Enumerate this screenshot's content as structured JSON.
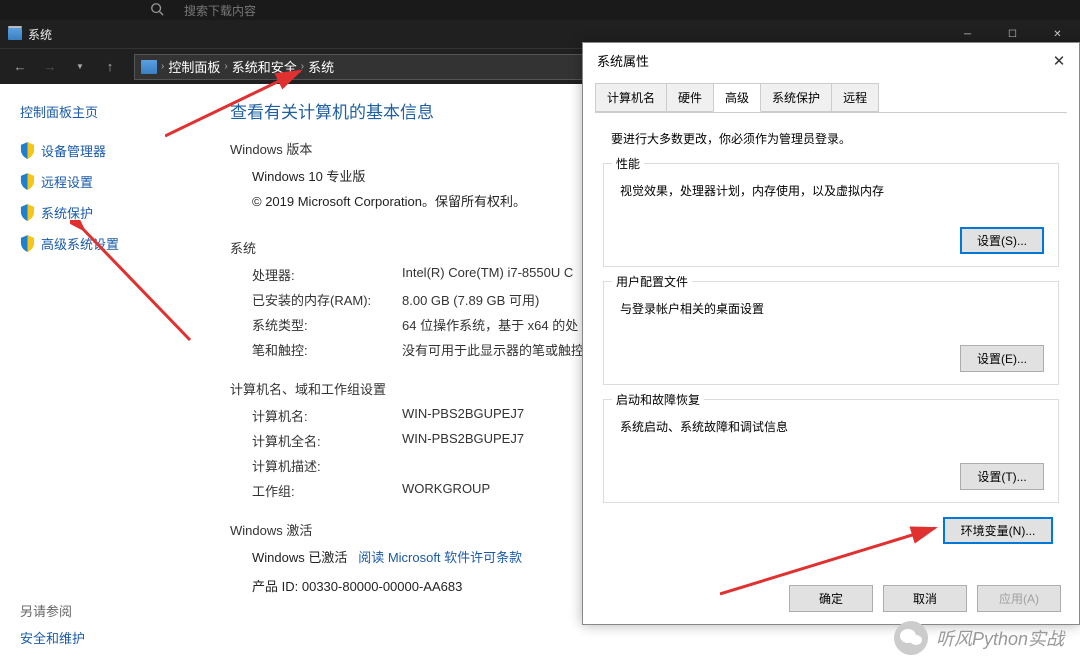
{
  "top_strip": {
    "search_placeholder": "搜索下载内容"
  },
  "title_bar": {
    "title": "系统"
  },
  "breadcrumb": {
    "items": [
      "控制面板",
      "系统和安全",
      "系统"
    ]
  },
  "sidebar": {
    "home": "控制面板主页",
    "items": [
      {
        "label": "设备管理器"
      },
      {
        "label": "远程设置"
      },
      {
        "label": "系统保护"
      },
      {
        "label": "高级系统设置"
      }
    ],
    "footer_title": "另请参阅",
    "footer_link": "安全和维护"
  },
  "main": {
    "heading": "查看有关计算机的基本信息",
    "win_edition_title": "Windows 版本",
    "win_edition": "Windows 10 专业版",
    "copyright": "© 2019 Microsoft Corporation。保留所有权利。",
    "system_title": "系统",
    "rows": {
      "cpu_k": "处理器:",
      "cpu_v": "Intel(R) Core(TM) i7-8550U C",
      "ram_k": "已安装的内存(RAM):",
      "ram_v": "8.00 GB (7.89 GB 可用)",
      "type_k": "系统类型:",
      "type_v": "64 位操作系统，基于 x64 的处",
      "pen_k": "笔和触控:",
      "pen_v": "没有可用于此显示器的笔或触控"
    },
    "name_title": "计算机名、域和工作组设置",
    "name_rows": {
      "name_k": "计算机名:",
      "name_v": "WIN-PBS2BGUPEJ7",
      "full_k": "计算机全名:",
      "full_v": "WIN-PBS2BGUPEJ7",
      "desc_k": "计算机描述:",
      "desc_v": "",
      "wg_k": "工作组:",
      "wg_v": "WORKGROUP"
    },
    "act_title": "Windows 激活",
    "act_status": "Windows 已激活",
    "act_link": "阅读 Microsoft 软件许可条款",
    "pid_k": "产品 ID:",
    "pid_v": "00330-80000-00000-AA683"
  },
  "dialog": {
    "title": "系统属性",
    "tabs": [
      "计算机名",
      "硬件",
      "高级",
      "系统保护",
      "远程"
    ],
    "active_tab": 2,
    "admin_note": "要进行大多数更改，你必须作为管理员登录。",
    "groups": [
      {
        "title": "性能",
        "desc": "视觉效果，处理器计划，内存使用，以及虚拟内存",
        "btn": "设置(S)...",
        "focus": true
      },
      {
        "title": "用户配置文件",
        "desc": "与登录帐户相关的桌面设置",
        "btn": "设置(E)..."
      },
      {
        "title": "启动和故障恢复",
        "desc": "系统启动、系统故障和调试信息",
        "btn": "设置(T)..."
      }
    ],
    "env_btn": "环境变量(N)...",
    "footer": {
      "ok": "确定",
      "cancel": "取消",
      "apply": "应用(A)"
    }
  },
  "watermark": "听风Python实战"
}
